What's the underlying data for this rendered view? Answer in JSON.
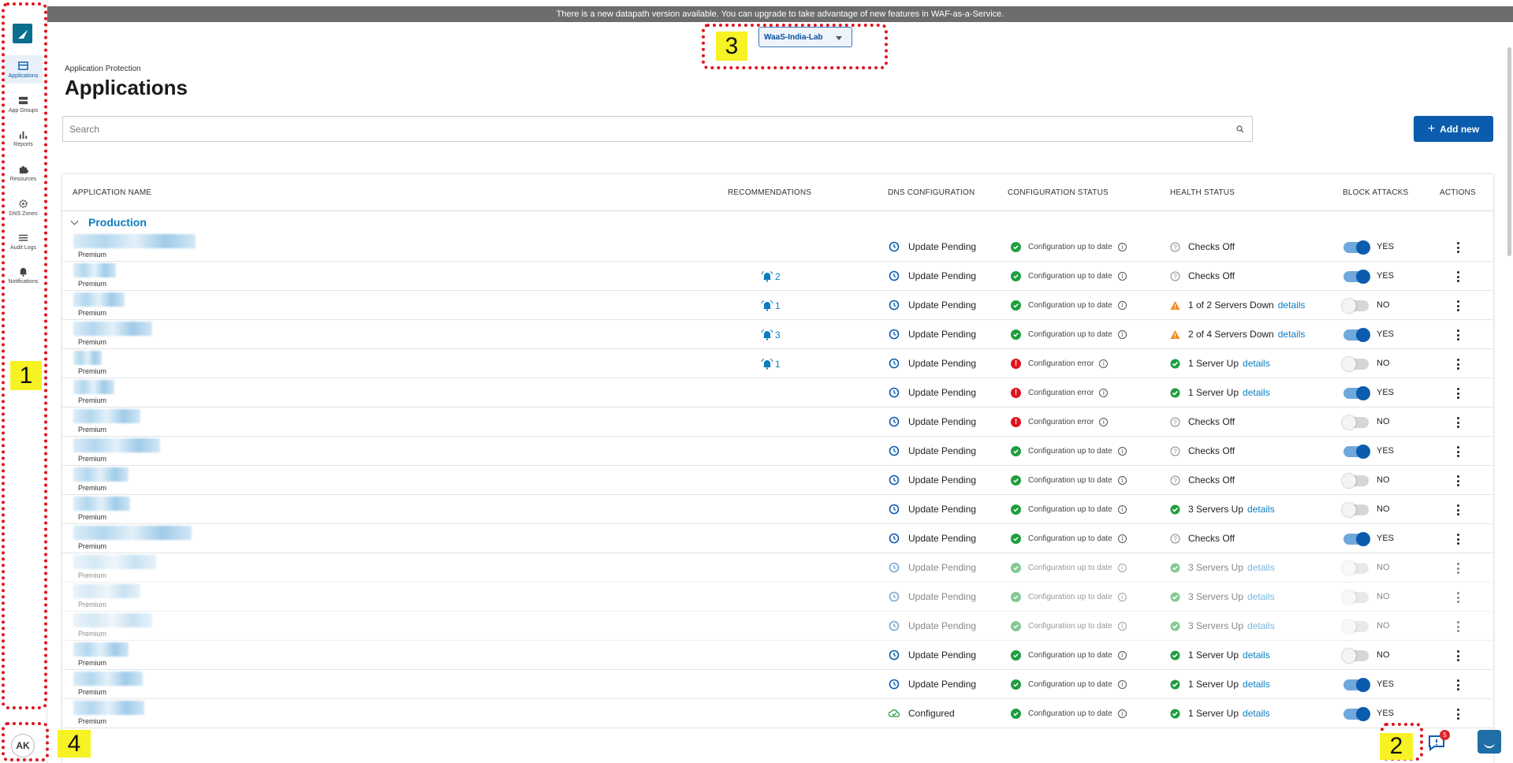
{
  "banner": {
    "text": "There is a new datapath version available. You can upgrade to take advantage of new features in WAF-as-a-Service."
  },
  "account": {
    "selected": "WaaS-India-Lab"
  },
  "sidebar": {
    "items": [
      {
        "label": "Applications",
        "icon": "applications-icon",
        "active": true
      },
      {
        "label": "App Groups",
        "icon": "app-groups-icon",
        "active": false
      },
      {
        "label": "Reports",
        "icon": "reports-icon",
        "active": false
      },
      {
        "label": "Resources",
        "icon": "puzzle-icon",
        "active": false
      },
      {
        "label": "DNS Zones",
        "icon": "gear-icon",
        "active": false
      },
      {
        "label": "Audit Logs",
        "icon": "list-icon",
        "active": false
      },
      {
        "label": "Notifications",
        "icon": "bell-icon",
        "active": false
      }
    ],
    "user_initials": "AK"
  },
  "page": {
    "breadcrumb": "Application Protection",
    "title": "Applications"
  },
  "search": {
    "placeholder": "Search"
  },
  "add_button": {
    "label": "Add new"
  },
  "table": {
    "headers": {
      "name": "APPLICATION NAME",
      "recommendations": "RECOMMENDATIONS",
      "dns": "DNS CONFIGURATION",
      "config": "CONFIGURATION STATUS",
      "health": "HEALTH STATUS",
      "block": "BLOCK ATTACKS",
      "actions": "ACTIONS"
    },
    "group": "Production",
    "rows": [
      {
        "tier": "Premium",
        "rec": "",
        "dns": "Update Pending",
        "config": "Configuration up to date",
        "config_ok": true,
        "health": "Checks Off",
        "health_kind": "off",
        "details": "",
        "block": "YES",
        "dim": false
      },
      {
        "tier": "Premium",
        "rec": "2",
        "dns": "Update Pending",
        "config": "Configuration up to date",
        "config_ok": true,
        "health": "Checks Off",
        "health_kind": "off",
        "details": "",
        "block": "YES",
        "dim": false
      },
      {
        "tier": "Premium",
        "rec": "1",
        "dns": "Update Pending",
        "config": "Configuration up to date",
        "config_ok": true,
        "health": "1 of 2 Servers Down",
        "health_kind": "warn",
        "details": "details",
        "block": "NO",
        "dim": false
      },
      {
        "tier": "Premium",
        "rec": "3",
        "dns": "Update Pending",
        "config": "Configuration up to date",
        "config_ok": true,
        "health": "2 of 4 Servers Down",
        "health_kind": "warn",
        "details": "details",
        "block": "YES",
        "dim": false
      },
      {
        "tier": "Premium",
        "rec": "1",
        "dns": "Update Pending",
        "config": "Configuration error",
        "config_ok": false,
        "health": "1 Server Up",
        "health_kind": "ok",
        "details": "details",
        "block": "NO",
        "dim": false
      },
      {
        "tier": "Premium",
        "rec": "",
        "dns": "Update Pending",
        "config": "Configuration error",
        "config_ok": false,
        "health": "1 Server Up",
        "health_kind": "ok",
        "details": "details",
        "block": "YES",
        "dim": false
      },
      {
        "tier": "Premium",
        "rec": "",
        "dns": "Update Pending",
        "config": "Configuration error",
        "config_ok": false,
        "health": "Checks Off",
        "health_kind": "off",
        "details": "",
        "block": "NO",
        "dim": false
      },
      {
        "tier": "Premium",
        "rec": "",
        "dns": "Update Pending",
        "config": "Configuration up to date",
        "config_ok": true,
        "health": "Checks Off",
        "health_kind": "off",
        "details": "",
        "block": "YES",
        "dim": false
      },
      {
        "tier": "Premium",
        "rec": "",
        "dns": "Update Pending",
        "config": "Configuration up to date",
        "config_ok": true,
        "health": "Checks Off",
        "health_kind": "off",
        "details": "",
        "block": "NO",
        "dim": false
      },
      {
        "tier": "Premium",
        "rec": "",
        "dns": "Update Pending",
        "config": "Configuration up to date",
        "config_ok": true,
        "health": "3 Servers Up",
        "health_kind": "ok",
        "details": "details",
        "block": "NO",
        "dim": false
      },
      {
        "tier": "Premium",
        "rec": "",
        "dns": "Update Pending",
        "config": "Configuration up to date",
        "config_ok": true,
        "health": "Checks Off",
        "health_kind": "off",
        "details": "",
        "block": "YES",
        "dim": false
      },
      {
        "tier": "Premium",
        "rec": "",
        "dns": "Update Pending",
        "config": "Configuration up to date",
        "config_ok": true,
        "health": "3 Servers Up",
        "health_kind": "ok",
        "details": "details",
        "block": "NO",
        "dim": true
      },
      {
        "tier": "Premium",
        "rec": "",
        "dns": "Update Pending",
        "config": "Configuration up to date",
        "config_ok": true,
        "health": "3 Servers Up",
        "health_kind": "ok",
        "details": "details",
        "block": "NO",
        "dim": true
      },
      {
        "tier": "Premium",
        "rec": "",
        "dns": "Update Pending",
        "config": "Configuration up to date",
        "config_ok": true,
        "health": "3 Servers Up",
        "health_kind": "ok",
        "details": "details",
        "block": "NO",
        "dim": true
      },
      {
        "tier": "Premium",
        "rec": "",
        "dns": "Update Pending",
        "config": "Configuration up to date",
        "config_ok": true,
        "health": "1 Server Up",
        "health_kind": "ok",
        "details": "details",
        "block": "NO",
        "dim": false
      },
      {
        "tier": "Premium",
        "rec": "",
        "dns": "Update Pending",
        "config": "Configuration up to date",
        "config_ok": true,
        "health": "1 Server Up",
        "health_kind": "ok",
        "details": "details",
        "block": "YES",
        "dim": false
      },
      {
        "tier": "Premium",
        "rec": "",
        "dns": "Configured",
        "config": "Configuration up to date",
        "config_ok": true,
        "health": "1 Server Up",
        "health_kind": "ok",
        "details": "details",
        "block": "YES",
        "dim": false
      }
    ]
  },
  "chat": {
    "badge": "5"
  },
  "annotations": [
    "1",
    "2",
    "3",
    "4"
  ],
  "colors": {
    "accent": "#0b5cad",
    "link": "#0b7dc1",
    "ok": "#1e9e3e",
    "error": "#e0141e",
    "warn": "#f08c2a",
    "annotation": "#e0141e",
    "annotation_label": "#f7f224"
  }
}
